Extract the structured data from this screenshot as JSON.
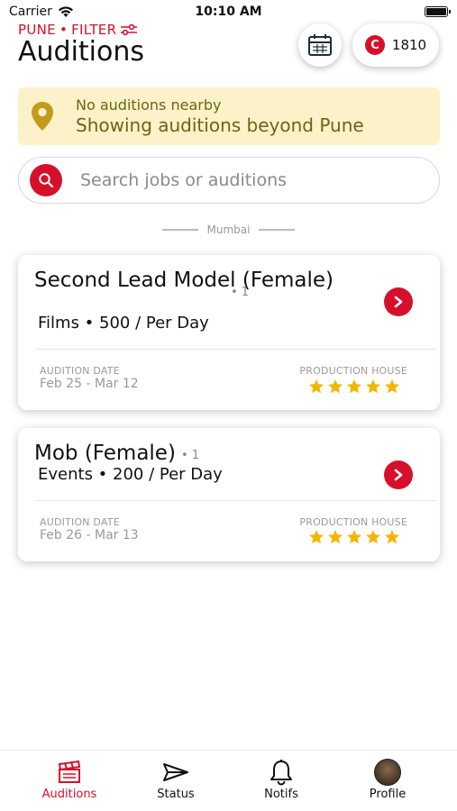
{
  "status_bar": {
    "carrier": "Carrier",
    "time": "10:10 AM",
    "battery_level": 1.0
  },
  "header": {
    "location": "PUNE",
    "separator": "•",
    "filter_label": "FILTER",
    "title": "Auditions",
    "coins": "1810",
    "coin_letter": "C"
  },
  "banner": {
    "line1": "No auditions nearby",
    "line2": "Showing auditions beyond Pune"
  },
  "search": {
    "placeholder": "Search jobs or auditions"
  },
  "section": {
    "city": "Mumbai"
  },
  "cards": [
    {
      "title": "Second Lead Model (Female)",
      "count": "• 1",
      "subtitle": "Films • 500 / Per Day",
      "date_label": "AUDITION DATE",
      "date_value": "Feb 25 - Mar 12",
      "house_label": "PRODUCTION HOUSE",
      "rating": 5
    },
    {
      "title": "Mob (Female)",
      "count": "• 1",
      "subtitle": "Events • 200 / Per Day",
      "date_label": "AUDITION DATE",
      "date_value": "Feb 26 - Mar 13",
      "house_label": "PRODUCTION HOUSE",
      "rating": 5
    }
  ],
  "tabs": [
    {
      "label": "Auditions",
      "icon": "clapperboard-icon",
      "active": true
    },
    {
      "label": "Status",
      "icon": "paper-plane-icon",
      "active": false
    },
    {
      "label": "Notifs",
      "icon": "bell-icon",
      "active": false
    },
    {
      "label": "Profile",
      "icon": "avatar",
      "active": false
    }
  ],
  "colors": {
    "accent": "#d6102a",
    "banner_bg": "#fdf1c9",
    "banner_text": "#6b6516",
    "star": "#f2b705"
  }
}
